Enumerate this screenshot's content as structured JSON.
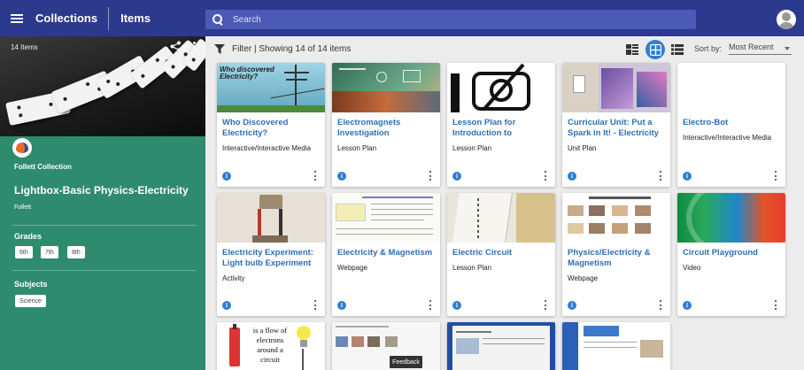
{
  "topbar": {
    "collections_label": "Collections",
    "items_label": "Items",
    "search_placeholder": "Search"
  },
  "sidebar": {
    "item_count": "14 Items",
    "publisher": "Follett Collection",
    "title": "Lightbox-Basic Physics-Electricity",
    "author": "Follett",
    "grades_label": "Grades",
    "grades": [
      "6th",
      "7th",
      "8th"
    ],
    "subjects_label": "Subjects",
    "subjects": [
      "Science"
    ]
  },
  "toolbar": {
    "filter_text": "Filter | Showing 14 of 14 items",
    "sort_label": "Sort by:",
    "sort_value": "Most Recent"
  },
  "cards": [
    {
      "title": "Who Discovered Electricity?",
      "type": "Interactive/Interactive Media",
      "thumb_text": "Who discovered Electricity?"
    },
    {
      "title": "Electromagnets Investigation",
      "type": "Lesson Plan"
    },
    {
      "title": "Lesson Plan for Introduction to",
      "type": "Lesson Plan"
    },
    {
      "title": "Curricular Unit: Put a Spark in It! - Electricity",
      "type": "Unit Plan"
    },
    {
      "title": "Electro-Bot",
      "type": "Interactive/Interactive Media"
    },
    {
      "title": "Electricity Experiment: Light bulb Experiment",
      "type": "Activity"
    },
    {
      "title": "Electricity & Magnetism",
      "type": "Webpage"
    },
    {
      "title": "Electric Circuit",
      "type": "Lesson Plan"
    },
    {
      "title": "Physics/Electricity & Magnetism",
      "type": "Webpage"
    },
    {
      "title": "Circuit Playground",
      "type": "Video"
    },
    {
      "thumb_text": "is a flow of electrons around a circuit"
    },
    {},
    {},
    {}
  ],
  "info_glyph": "i",
  "feedback_label": "Feedback",
  "colors": {
    "topbar": "#2c3a8e",
    "search": "#4a5ab6",
    "sidebar": "#2e8b6e",
    "link": "#2e6fb5",
    "accent": "#2f7fd3"
  }
}
